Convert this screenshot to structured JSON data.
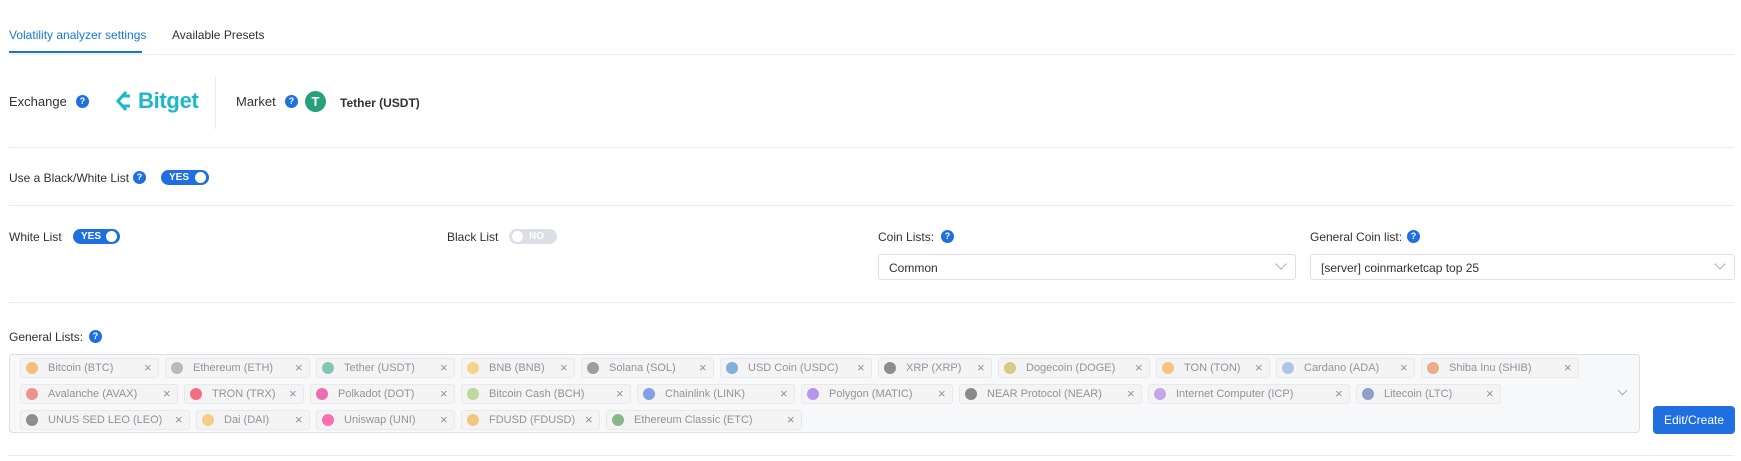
{
  "tabs": [
    "Volatility analyzer settings",
    "Available Presets"
  ],
  "exchange": {
    "label": "Exchange",
    "logo_text": "Bitget"
  },
  "market": {
    "label": "Market",
    "value": "Tether (USDT)",
    "icon_letter": "T"
  },
  "bw_list": {
    "label": "Use a Black/White List",
    "toggle": "YES"
  },
  "white_list": {
    "label": "White List",
    "toggle": "YES"
  },
  "black_list": {
    "label": "Black List",
    "toggle": "NO"
  },
  "coin_lists": {
    "label": "Coin Lists:",
    "value": "Common"
  },
  "general_coin_list": {
    "label": "General Coin list:",
    "value": "[server] coinmarketcap top 25"
  },
  "general_lists": {
    "label": "General Lists:",
    "tags": [
      {
        "name": "Bitcoin (BTC)",
        "color": "#f7931a"
      },
      {
        "name": "Ethereum (ETH)",
        "color": "#8a8a8a"
      },
      {
        "name": "Tether (USDT)",
        "color": "#26a17b"
      },
      {
        "name": "BNB (BNB)",
        "color": "#f3ba2f"
      },
      {
        "name": "Solana (SOL)",
        "color": "#555555"
      },
      {
        "name": "USD Coin (USDC)",
        "color": "#2775ca"
      },
      {
        "name": "XRP (XRP)",
        "color": "#3a3a3a"
      },
      {
        "name": "Dogecoin (DOGE)",
        "color": "#c2a633"
      },
      {
        "name": "TON (TON)",
        "color": "#f0a020"
      },
      {
        "name": "Cardano (ADA)",
        "color": "#7a9bd6"
      },
      {
        "name": "Shiba Inu (SHIB)",
        "color": "#e0762b"
      },
      {
        "name": "Avalanche (AVAX)",
        "color": "#e84142"
      },
      {
        "name": "TRON (TRX)",
        "color": "#ef0027"
      },
      {
        "name": "Polkadot (DOT)",
        "color": "#e6007a"
      },
      {
        "name": "Bitcoin Cash (BCH)",
        "color": "#8dc351"
      },
      {
        "name": "Chainlink (LINK)",
        "color": "#2a5ada"
      },
      {
        "name": "Polygon (MATIC)",
        "color": "#8247e5"
      },
      {
        "name": "NEAR Protocol (NEAR)",
        "color": "#333333"
      },
      {
        "name": "Internet Computer (ICP)",
        "color": "#9a6ad8"
      },
      {
        "name": "Litecoin (LTC)",
        "color": "#345d9d"
      },
      {
        "name": "UNUS SED LEO (LEO)",
        "color": "#3b3b3b"
      },
      {
        "name": "Dai (DAI)",
        "color": "#f5ac37"
      },
      {
        "name": "Uniswap (UNI)",
        "color": "#ff007a"
      },
      {
        "name": "FDUSD (FDUSD)",
        "color": "#f0a020"
      },
      {
        "name": "Ethereum Classic (ETC)",
        "color": "#328332"
      }
    ]
  },
  "edit_button": "Edit/Create",
  "colors": {
    "accent": "#1f6fe0",
    "link": "#1677d8",
    "bitget": "#1cb8c8"
  }
}
